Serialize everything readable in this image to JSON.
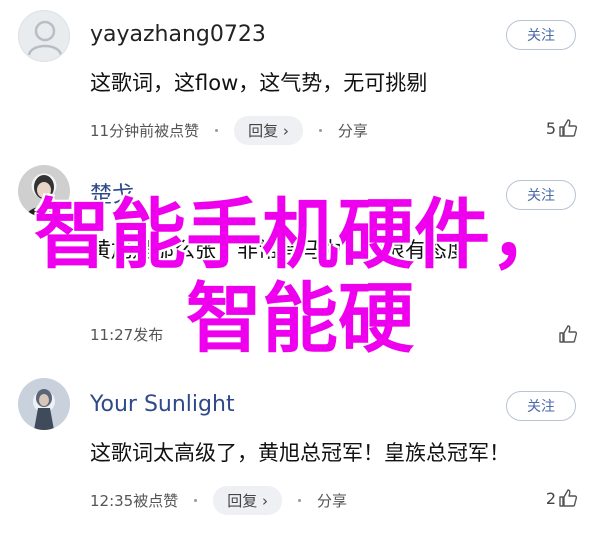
{
  "comments": [
    {
      "username": "yayazhang0723",
      "follow_label": "关注",
      "content": "这歌词，这flow，这气势，无可挑剔",
      "meta_time": "11分钟前被点赞",
      "reply_label": "回复 ›",
      "share_label": "分享",
      "like_count": "5"
    },
    {
      "username": "楚戈",
      "follow_label": "关注",
      "content": "黄旭是那么张，非常有马力，但很有态度",
      "meta_time": "11:27发布",
      "like_count": ""
    },
    {
      "username": "Your Sunlight",
      "follow_label": "关注",
      "content": "这歌词太高级了，黄旭总冠军！皇族总冠军！",
      "meta_time": "12:35被点赞",
      "reply_label": "回复 ›",
      "share_label": "分享",
      "like_count": "2"
    }
  ],
  "overlay": {
    "line1": "智能手机硬件，",
    "line2": "智能硬"
  },
  "colors": {
    "overlay_text": "#ee00ee",
    "username_blue": "#2f4a8a",
    "follow_border": "#b9c3d3"
  }
}
